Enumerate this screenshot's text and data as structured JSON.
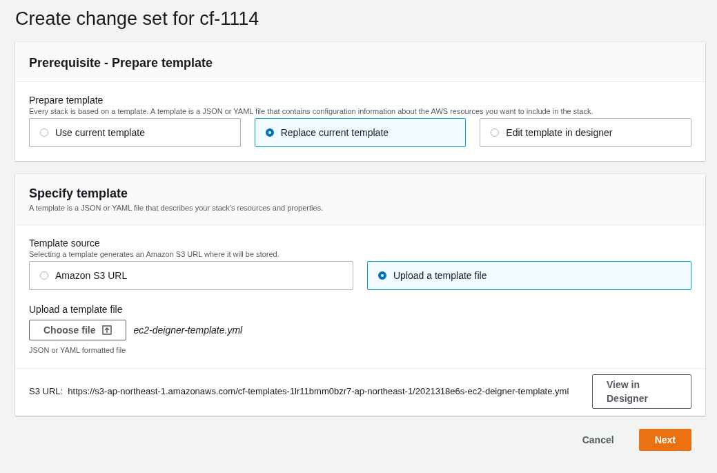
{
  "page_title": "Create change set for cf-1114",
  "prerequisite": {
    "heading": "Prerequisite - Prepare template",
    "label": "Prepare template",
    "description": "Every stack is based on a template. A template is a JSON or YAML file that contains configuration information about the AWS resources you want to include in the stack.",
    "options": [
      {
        "label": "Use current template",
        "selected": false
      },
      {
        "label": "Replace current template",
        "selected": true
      },
      {
        "label": "Edit template in designer",
        "selected": false
      }
    ]
  },
  "specify": {
    "heading": "Specify template",
    "subheading": "A template is a JSON or YAML file that describes your stack's resources and properties.",
    "source_label": "Template source",
    "source_description": "Selecting a template generates an Amazon S3 URL where it will be stored.",
    "sources": [
      {
        "label": "Amazon S3 URL",
        "selected": false
      },
      {
        "label": "Upload a template file",
        "selected": true
      }
    ],
    "upload_label": "Upload a template file",
    "choose_button": "Choose file",
    "file_name": "ec2-deigner-template.yml",
    "upload_hint": "JSON or YAML formatted file",
    "s3_label": "S3 URL:",
    "s3_url": "https://s3-ap-northeast-1.amazonaws.com/cf-templates-1lr11bmm0bzr7-ap-northeast-1/2021318e6s-ec2-deigner-template.yml",
    "designer_button": "View in Designer"
  },
  "footer": {
    "cancel": "Cancel",
    "next": "Next"
  }
}
